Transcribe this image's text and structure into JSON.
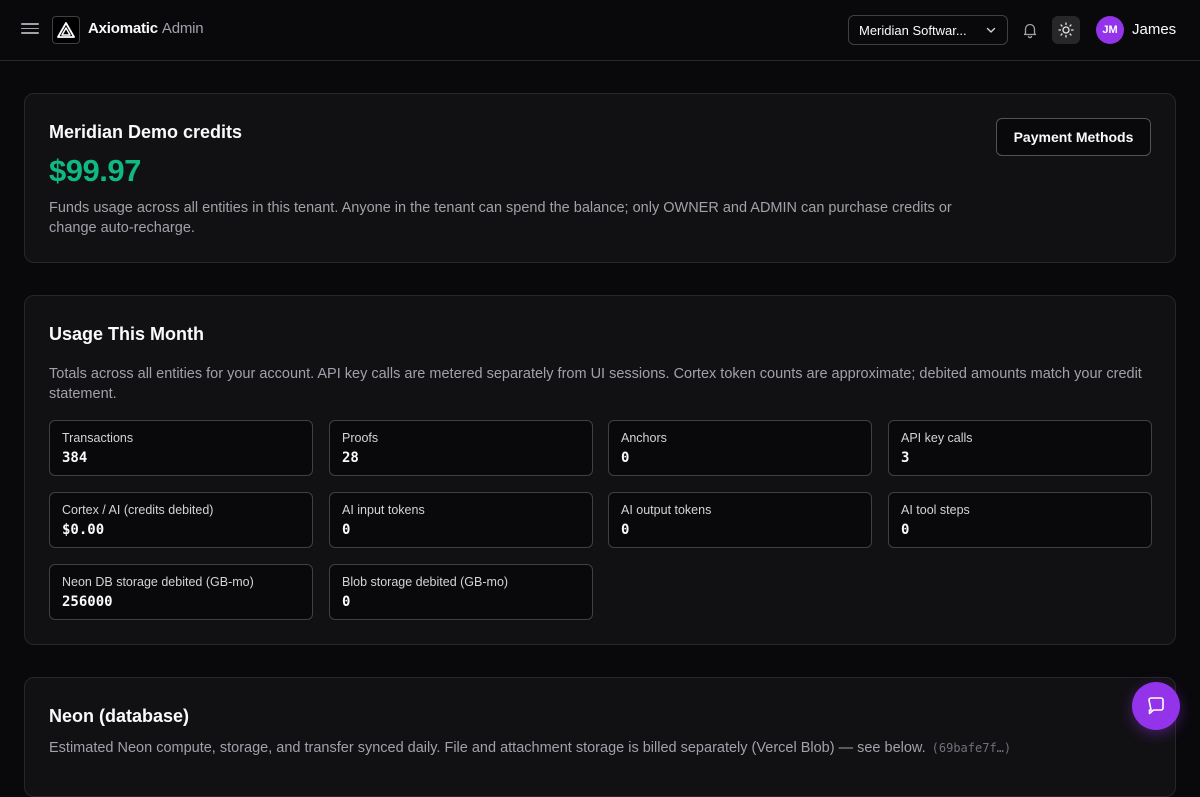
{
  "header": {
    "brand_name": "Axiomatic",
    "brand_suffix": "Admin",
    "tenant_selected": "Meridian Softwar...",
    "user_initials": "JM",
    "user_name": "James",
    "icons": [
      "menu-icon",
      "logo-icon",
      "chevron-down-icon",
      "bell-icon",
      "sun-icon"
    ]
  },
  "credits": {
    "title": "Meridian Demo credits",
    "balance": "$99.97",
    "description": "Funds usage across all entities in this tenant. Anyone in the tenant can spend the balance; only OWNER and ADMIN can purchase credits or change auto-recharge.",
    "payment_button": "Payment Methods"
  },
  "usage": {
    "title": "Usage This Month",
    "description": "Totals across all entities for your account. API key calls are metered separately from UI sessions. Cortex token counts are approximate; debited amounts match your credit statement.",
    "stats": [
      {
        "label": "Transactions",
        "value": "384"
      },
      {
        "label": "Proofs",
        "value": "28"
      },
      {
        "label": "Anchors",
        "value": "0"
      },
      {
        "label": "API key calls",
        "value": "3"
      },
      {
        "label": "Cortex / AI (credits debited)",
        "value": "$0.00"
      },
      {
        "label": "AI input tokens",
        "value": "0"
      },
      {
        "label": "AI output tokens",
        "value": "0"
      },
      {
        "label": "AI tool steps",
        "value": "0"
      },
      {
        "label": "Neon DB storage debited (GB-mo)",
        "value": "256000"
      },
      {
        "label": "Blob storage debited (GB-mo)",
        "value": "0"
      }
    ]
  },
  "neon": {
    "title": "Neon (database)",
    "description": "Estimated Neon compute, storage, and transfer synced daily. File and attachment storage is billed separately (Vercel Blob) — see below.",
    "code": "(69bafe7f…)"
  },
  "colors": {
    "background": "#09090b",
    "card": "#111113",
    "accent_green": "#10b981",
    "accent_purple": "#9333ea"
  }
}
